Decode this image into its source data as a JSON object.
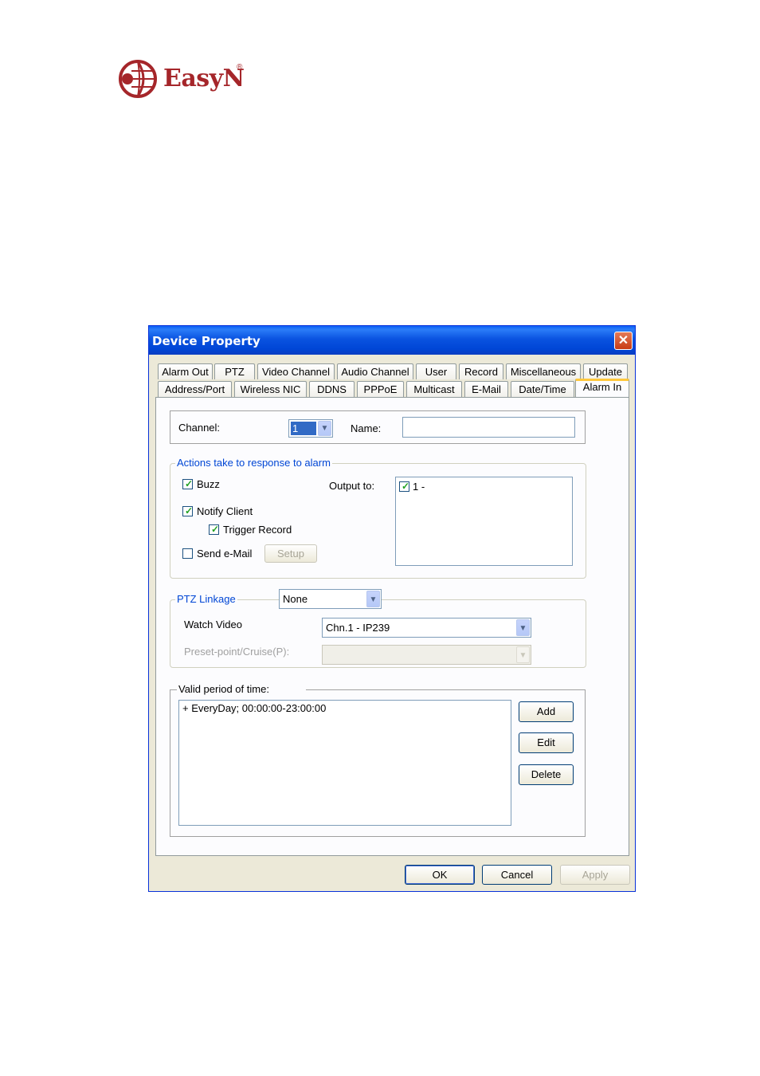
{
  "logo": {
    "brand": "EasyN",
    "registered": "®"
  },
  "window": {
    "title": "Device Property",
    "close_icon": "close-icon"
  },
  "tabs_row1": [
    "Alarm Out",
    "PTZ",
    "Video Channel",
    "Audio Channel",
    "User",
    "Record",
    "Miscellaneous",
    "Update"
  ],
  "tabs_row2": [
    "Address/Port",
    "Wireless NIC",
    "DDNS",
    "PPPoE",
    "Multicast",
    "E-Mail",
    "Date/Time",
    "Alarm In"
  ],
  "active_tab": "Alarm In",
  "channel": {
    "label": "Channel:",
    "value": "1",
    "name_label": "Name:",
    "name_value": ""
  },
  "actions": {
    "legend": "Actions take to response to alarm",
    "buzz": {
      "label": "Buzz",
      "checked": true
    },
    "notify_client": {
      "label": "Notify Client",
      "checked": true
    },
    "trigger_record": {
      "label": "Trigger Record",
      "checked": true
    },
    "send_email": {
      "label": "Send e-Mail",
      "checked": false
    },
    "setup_label": "Setup",
    "output_to_label": "Output to:",
    "outputs": [
      {
        "label": "1 -",
        "checked": true
      }
    ]
  },
  "ptz": {
    "legend": "PTZ Linkage",
    "linkage_value": "None",
    "watch_video_label": "Watch Video",
    "watch_video_value": "Chn.1 - IP239",
    "preset_label": "Preset-point/Cruise(P):",
    "preset_value": ""
  },
  "period": {
    "legend": "Valid period of time:",
    "entries": [
      "+ EveryDay; 00:00:00-23:00:00"
    ],
    "add_label": "Add",
    "edit_label": "Edit",
    "delete_label": "Delete"
  },
  "footer": {
    "ok_label": "OK",
    "cancel_label": "Cancel",
    "apply_label": "Apply"
  },
  "colors": {
    "brand": "#a5262a",
    "titlebar": "#0a53e0",
    "active_tab_accent": "#ffc83c",
    "check": "#21a121"
  }
}
